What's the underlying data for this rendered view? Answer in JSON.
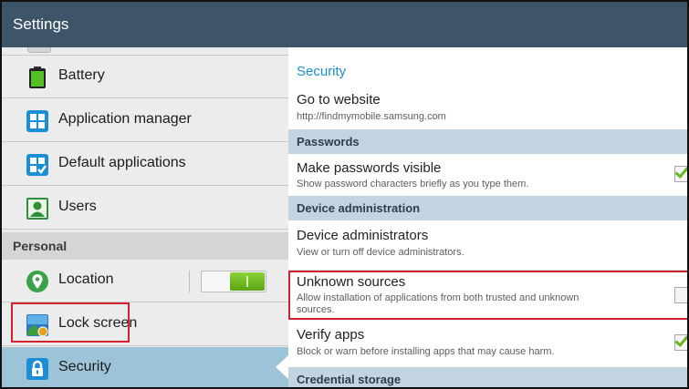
{
  "title_bar": {
    "title": "Settings"
  },
  "sidebar": {
    "items": [
      {
        "label": "Battery",
        "icon": "battery-icon"
      },
      {
        "label": "Application manager",
        "icon": "application-manager-icon"
      },
      {
        "label": "Default applications",
        "icon": "default-applications-icon"
      },
      {
        "label": "Users",
        "icon": "users-icon"
      }
    ],
    "section_personal": "Personal",
    "location": {
      "label": "Location",
      "icon": "location-pin-icon",
      "toggle_on": true
    },
    "lock_screen": {
      "label": "Lock screen",
      "icon": "lock-screen-icon"
    },
    "security": {
      "label": "Security",
      "icon": "padlock-icon",
      "selected": true
    }
  },
  "panel": {
    "title": "Security",
    "go_to_website": {
      "title": "Go to website",
      "subtitle": "http://findmymobile.samsung.com"
    },
    "section_passwords": "Passwords",
    "make_passwords_visible": {
      "title": "Make passwords visible",
      "subtitle": "Show password characters briefly as you type them.",
      "checked": true
    },
    "section_device_admin": "Device administration",
    "device_administrators": {
      "title": "Device administrators",
      "subtitle": "View or turn off device administrators."
    },
    "unknown_sources": {
      "title": "Unknown sources",
      "subtitle_line1": "Allow installation of applications from both trusted and unknown",
      "subtitle_line2": "sources.",
      "checked": false
    },
    "verify_apps": {
      "title": "Verify apps",
      "subtitle": "Block or warn before installing apps that may cause harm.",
      "checked": true
    },
    "section_credential_storage": "Credential storage"
  },
  "colors": {
    "title_bar": "#3e5468",
    "accent_blue": "#1b8fc4",
    "selected_row": "#9cc3d8",
    "highlight_red": "#d1222e",
    "check_green": "#66b71d"
  }
}
